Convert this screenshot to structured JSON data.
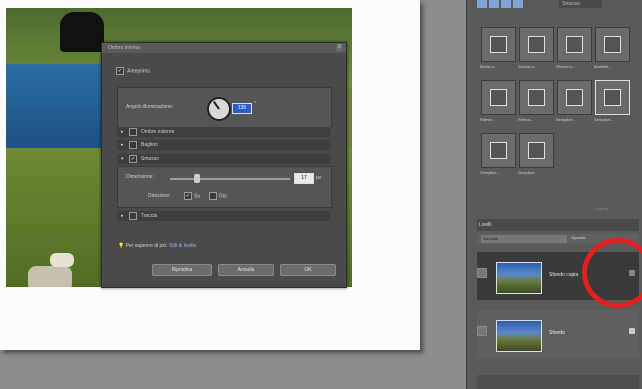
{
  "dialog": {
    "title": "Ombra interna",
    "close_label": "x",
    "anteprima_label": "Anteprima",
    "anteprima_checked": "✓",
    "angle_label": "Angolo illuminazione:",
    "angle_value": "135",
    "angle_unit": "°",
    "sections": [
      {
        "label": "Ombre esterne",
        "checked": ""
      },
      {
        "label": "Bagliori",
        "checked": ""
      },
      {
        "label": "Smusso",
        "checked": "✓"
      },
      {
        "label": "Traccia",
        "checked": ""
      }
    ],
    "dimension_label": "Dimensione:",
    "dimension_value": "17",
    "dimension_unit": "px",
    "direction_label": "Direzione:",
    "direction_up": "Su",
    "direction_down": "Giù",
    "hint_text": "Per saperne di più:",
    "hint_link": "Stili di livello",
    "buttons": {
      "reset": "Ripristina",
      "cancel": "Annulla",
      "ok": "OK"
    }
  },
  "right_panel": {
    "mode_dropdown": "Smusso",
    "effects": [
      {
        "label": "Bordo s..."
      },
      {
        "label": "Sfondo s..."
      },
      {
        "label": "Sfondo s..."
      },
      {
        "label": "Modello..."
      },
      {
        "label": "Rilievo..."
      },
      {
        "label": "Rilievo..."
      },
      {
        "label": "Semplice..."
      },
      {
        "label": "Semplice..."
      },
      {
        "label": "Semplice..."
      },
      {
        "label": "Semplice..."
      }
    ],
    "apply_label": "Applica",
    "layers_title": "Livelli",
    "blend_mode": "Normale",
    "opacity_label": "Opacità:",
    "layers": [
      {
        "name": "Sfondo copia"
      },
      {
        "name": "Sfondo"
      }
    ]
  },
  "colors": {
    "highlight": "#e2201f",
    "selection_blue": "#2c5fc4"
  }
}
